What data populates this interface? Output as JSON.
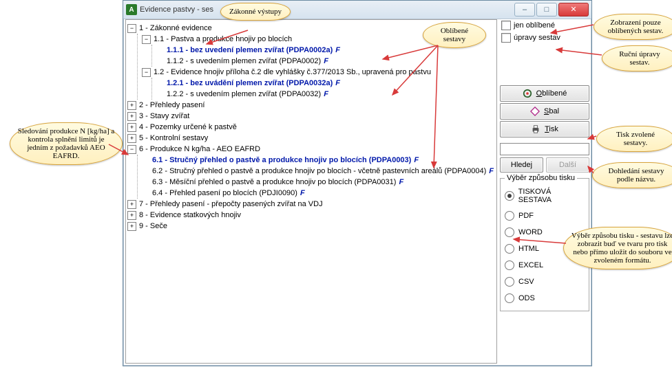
{
  "window": {
    "title": "Evidence pastvy - ses"
  },
  "tree": [
    {
      "exp": "minus",
      "label": "1 - Zákonné evidence",
      "children": [
        {
          "exp": "minus",
          "label": "1.1 - Pastva a produkce hnojiv po blocích",
          "children": [
            {
              "exp": "none",
              "label": "1.1.1 - bez uvedení plemen zvířat (PDPA0002a)",
              "fav": true
            },
            {
              "exp": "none",
              "label": "1.1.2 - s uvedením plemen zvířat (PDPA0002)",
              "f": true
            }
          ]
        },
        {
          "exp": "minus",
          "label": "1.2 - Evidence hnojiv příloha č.2 dle vyhlášky č.377/2013 Sb., upravená pro pastvu",
          "children": [
            {
              "exp": "none",
              "label": "1.2.1 - bez uvádění plemen zvířat (PDPA0032a)",
              "fav": true
            },
            {
              "exp": "none",
              "label": "1.2.2 - s uvedením plemen zvířat (PDPA0032)",
              "f": true
            }
          ]
        }
      ]
    },
    {
      "exp": "plus",
      "label": "2 - Přehledy pasení"
    },
    {
      "exp": "plus",
      "label": "3 - Stavy zvířat"
    },
    {
      "exp": "plus",
      "label": "4 - Pozemky určené k pastvě"
    },
    {
      "exp": "plus",
      "label": "5 - Kontrolní sestavy"
    },
    {
      "exp": "minus",
      "label": "6 - Produkce N kg/ha - AEO EAFRD",
      "children": [
        {
          "exp": "none",
          "label": "6.1 - Stručný přehled o pastvě a produkce hnojiv po blocích (PDPA0003)",
          "fav": true
        },
        {
          "exp": "none",
          "label": "6.2 - Stručný přehled o pastvě a produkce hnojiv po blocích - včetně pastevních areálů (PDPA0004)",
          "f": true
        },
        {
          "exp": "none",
          "label": "6.3 - Měsíční přehled o pastvě a produkce hnojiv po blocích (PDPA0031)",
          "f": true
        },
        {
          "exp": "none",
          "label": "6.4 - Přehled pasení po blocích (PDJI0090)",
          "f": true
        }
      ]
    },
    {
      "exp": "plus",
      "label": "7 - Přehledy pasení - přepočty pasených zvířat na VDJ"
    },
    {
      "exp": "plus",
      "label": "8 - Evidence statkových hnojiv"
    },
    {
      "exp": "plus",
      "label": "9 - Seče"
    }
  ],
  "side": {
    "chk1": "jen oblíbené",
    "chk2": "úpravy sestav",
    "btn_fav": "Oblíbené",
    "btn_collapse": "Sbal",
    "btn_print": "Tisk",
    "btn_find": "Hledej",
    "btn_next": "Další",
    "group_title": "Výběr způsobu tisku",
    "radios": [
      "TISKOVÁ SESTAVA",
      "PDF",
      "WORD",
      "HTML",
      "EXCEL",
      "CSV",
      "ODS"
    ],
    "radio_selected": 0
  },
  "callouts": {
    "c1": "Zákonné\nvýstupy",
    "c2": "Oblíbené\nsestavy",
    "c3": "Zobrazení pouze\noblíbených sestav.",
    "c4": "Ruční úpravy\nsestav.",
    "c5": "Tisk zvolené\nsestavy.",
    "c6": "Dohledání sestavy\npodle názvu.",
    "c7": "Výběr způsobu tisku -\nsestavu lze zobrazit buď\nve tvaru pro tisk nebo\npřímo uložit do souboru\nve zvoleném formátu.",
    "c8": "Sledování produkce N\n[kg/ha] a kontrola\nsplnění limitů je jedním z\npožadavků AEO EAFRD."
  }
}
